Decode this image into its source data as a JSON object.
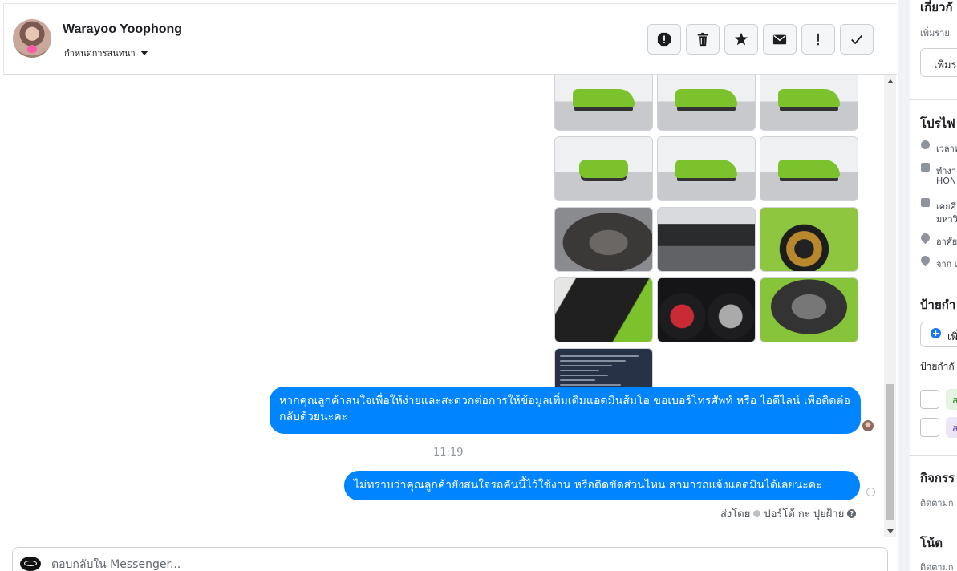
{
  "header": {
    "user_name": "Warayoo Yoophong",
    "convo_setting": "กำหนดการสนทนา",
    "actions": [
      "report-icon",
      "trash-icon",
      "star-icon",
      "envelope-icon",
      "exclamation-icon",
      "check-icon"
    ]
  },
  "messages": {
    "msg1": "หากคุณลูกค้าสนใจเพื่อให้ง่ายและสะดวกต่อการให้ข้อมูลเพิ่มเติมแอดมินส้มโอ ขอเบอร์โทรศัพท์ หรือ ไอดีไลน์ เพื่อติดต่อกลับด้วยนะคะ",
    "time": "11:19",
    "msg2": "ไม่ทราบว่าคุณลูกค้ายังสนใจรถคันนี้ไว้ใช้งาน หรือติดขัดส่วนไหน สามารถแจ้งแอดมินได้เลยนะคะ",
    "sent_by_label": "ส่งโดย",
    "sent_by_name": "ปอร์โต้ กะ ปุยฝ้าย"
  },
  "composer": {
    "placeholder": "ตอบกลับใน Messenger..."
  },
  "side": {
    "about_title": "เกี่ยวกั",
    "about_sub": "เพิ่มราย",
    "about_btn": "เพิ่มร",
    "profile_title": "โปรไฟ",
    "profile_time": "เวลาท",
    "profile_work": "ทำงา",
    "profile_work2": "HON",
    "profile_edu": "เคยศึ",
    "profile_edu2": "มหาวิ",
    "profile_live": "อาศัย",
    "profile_from": "จาก เ",
    "labels_title": "ป้ายกำ",
    "labels_add": "เพิ่",
    "labels_sub": "ป้ายกำกั",
    "tag1": "ส",
    "tag2": "ส",
    "activity_title": "กิจกรร",
    "activity_sub": "ติดตามก",
    "notes_title": "โน้ต",
    "notes_sub": "ติดตามก"
  },
  "colors": {
    "bubble": "#0084ff",
    "accent": "#1877f2"
  }
}
